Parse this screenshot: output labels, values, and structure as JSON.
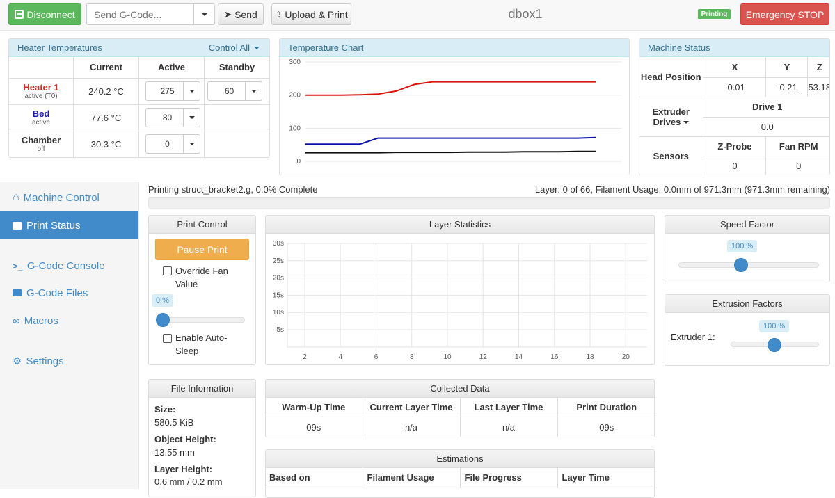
{
  "navbar": {
    "disconnect_label": "Disconnect",
    "gcode_placeholder": "Send G-Code...",
    "send_label": "Send",
    "upload_label": "Upload & Print",
    "machine_name": "dbox1",
    "status_badge": "Printing",
    "emergency_label": "Emergency STOP"
  },
  "heaters": {
    "title": "Heater Temperatures",
    "control_all": "Control All",
    "headers": [
      "Current",
      "Active",
      "Standby"
    ],
    "rows": [
      {
        "name": "Heater 1",
        "state_prefix": "active (",
        "tool": "T0",
        "state_suffix": ")",
        "current": "240.2 °C",
        "active": "275",
        "standby": "60"
      },
      {
        "name": "Bed",
        "state": "active",
        "current": "77.6 °C",
        "active": "80"
      },
      {
        "name": "Chamber",
        "state": "off",
        "current": "30.3 °C",
        "active": "0"
      }
    ]
  },
  "temp_chart": {
    "title": "Temperature Chart",
    "yticks": [
      "300",
      "200",
      "100",
      "0"
    ]
  },
  "chart_data": {
    "type": "line",
    "title": "Temperature Chart",
    "ylim": [
      0,
      300
    ],
    "yticks": [
      0,
      100,
      200,
      300
    ],
    "series": [
      {
        "color": "#d9160e",
        "values": [
          200,
          200,
          200,
          201,
          203,
          212,
          232,
          240,
          240,
          240,
          240,
          240,
          240,
          240,
          240,
          240,
          240
        ]
      },
      {
        "color": "#0d10a8",
        "values": [
          52,
          52,
          52,
          52,
          70,
          70,
          70,
          70,
          70,
          70,
          70,
          70,
          70,
          70,
          70,
          70,
          72
        ]
      },
      {
        "color": "#111111",
        "values": [
          26,
          26,
          26,
          26,
          26,
          27,
          27,
          27,
          27,
          28,
          28,
          28,
          29,
          29,
          29,
          30,
          30
        ]
      }
    ]
  },
  "machine_status": {
    "title": "Machine Status",
    "head_position_label": "Head Position",
    "axes": [
      "X",
      "Y",
      "Z"
    ],
    "positions": [
      "-0.01",
      "-0.21",
      "53.18"
    ],
    "extruder_drives_label": "Extruder Drives",
    "drive_label": "Drive 1",
    "drive_value": "0.0",
    "sensors_label": "Sensors",
    "zprobe_label": "Z-Probe",
    "fan_label": "Fan RPM",
    "zprobe_value": "0",
    "fan_value": "0"
  },
  "sidebar": {
    "items": [
      {
        "label": "Machine Control",
        "icon": "home-icon"
      },
      {
        "label": "Print Status",
        "icon": "printer-icon"
      },
      {
        "label": "G-Code Console",
        "icon": "terminal-icon"
      },
      {
        "label": "G-Code Files",
        "icon": "hdd-icon"
      },
      {
        "label": "Macros",
        "icon": "link-icon"
      },
      {
        "label": "Settings",
        "icon": "gear-icon"
      }
    ]
  },
  "progress": {
    "left_text": "Printing struct_bracket2.g, 0.0% Complete",
    "right_text": "Layer: 0 of 66, Filament Usage: 0.0mm of 971.3mm (971.3mm remaining)",
    "fraction": 0.0
  },
  "print_control": {
    "title": "Print Control",
    "pause_label": "Pause Print",
    "override_fan_label": "Override Fan Value",
    "fan_value": "0 %",
    "auto_sleep_label": "Enable Auto-Sleep"
  },
  "layer_stats": {
    "title": "Layer Statistics",
    "yticks": [
      "30s",
      "25s",
      "20s",
      "15s",
      "10s",
      "5s"
    ],
    "xticks": [
      "2",
      "4",
      "6",
      "8",
      "10",
      "12",
      "14",
      "16",
      "18",
      "20"
    ]
  },
  "speed_factor": {
    "title": "Speed Factor",
    "value": "100 %"
  },
  "extrusion": {
    "title": "Extrusion Factors",
    "extruder_label": "Extruder 1:",
    "value": "100 %"
  },
  "file_info": {
    "title": "File Information",
    "size_label": "Size:",
    "size_value": "580.5 KiB",
    "height_label": "Object Height:",
    "height_value": "13.55 mm",
    "layer_label": "Layer Height:",
    "layer_value": "0.6 mm / 0.2 mm"
  },
  "collected": {
    "title": "Collected Data",
    "headers": [
      "Warm-Up Time",
      "Current Layer Time",
      "Last Layer Time",
      "Print Duration"
    ],
    "values": [
      "09s",
      "n/a",
      "n/a",
      "09s"
    ]
  },
  "estimations": {
    "title": "Estimations",
    "headers": [
      "Based on",
      "Filament Usage",
      "File Progress",
      "Layer Time"
    ]
  }
}
